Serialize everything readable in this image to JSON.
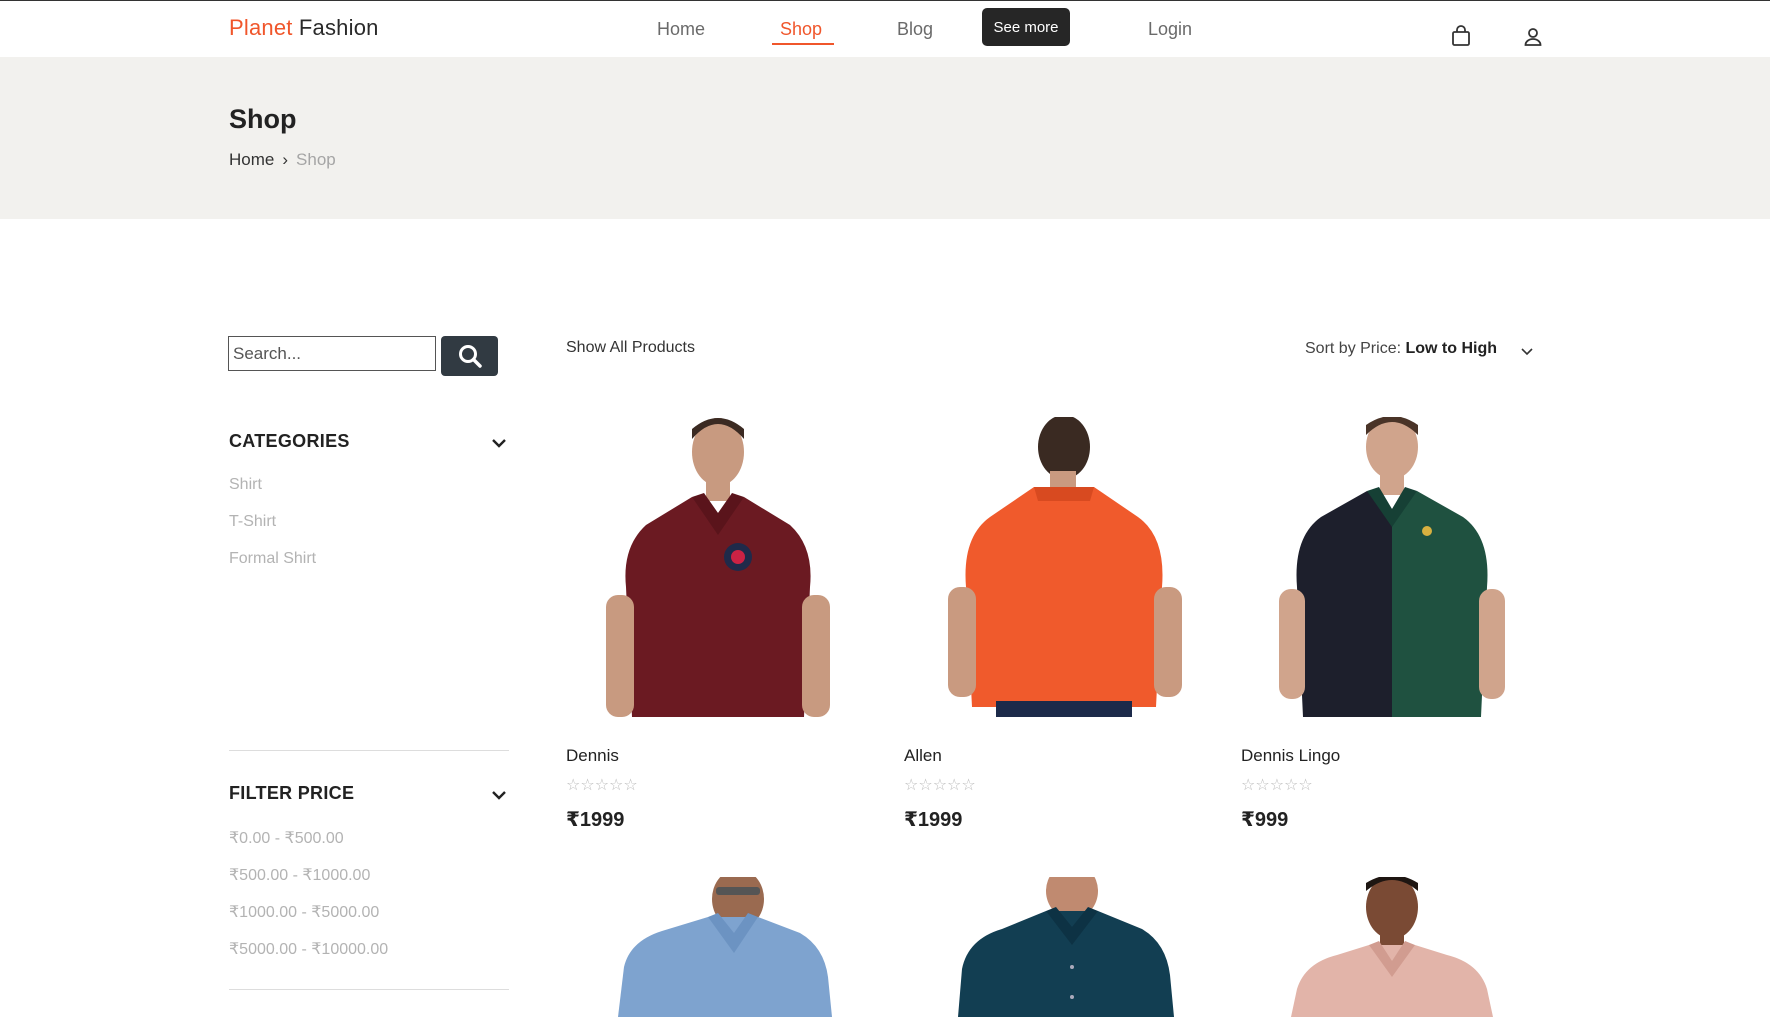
{
  "brand": {
    "part1": "Planet",
    "part2": "Fashion",
    "accent_color": "#f0562b"
  },
  "nav": {
    "home": "Home",
    "shop": "Shop",
    "blog": "Blog",
    "login": "Login",
    "tooltip": "See more"
  },
  "header_icons": [
    "shopping-bag-icon",
    "user-icon"
  ],
  "banner": {
    "title": "Shop",
    "breadcrumb": {
      "home": "Home",
      "separator": "›",
      "current": "Shop"
    }
  },
  "sidebar": {
    "search_placeholder": "Search...",
    "categories": {
      "title": "CATEGORIES",
      "items": [
        "Shirt",
        "T-Shirt",
        "Formal Shirt"
      ]
    },
    "filter_price": {
      "title": "FILTER PRICE",
      "items": [
        "₹0.00 - ₹500.00",
        "₹500.00 - ₹1000.00",
        "₹1000.00 - ₹5000.00",
        "₹5000.00 - ₹10000.00"
      ]
    }
  },
  "toolbar": {
    "show_all": "Show All Products",
    "sort_label": "Sort by Price:",
    "sort_value": "Low to High"
  },
  "products": [
    {
      "name": "Dennis",
      "rating": "☆☆☆☆☆",
      "price": "₹1999",
      "shirt_color": "#6b1a22"
    },
    {
      "name": "Allen",
      "rating": "☆☆☆☆☆",
      "price": "₹1999",
      "shirt_color": "#f05a2c"
    },
    {
      "name": "Dennis Lingo",
      "rating": "☆☆☆☆☆",
      "price": "₹999",
      "shirt_color": "#1f5140"
    },
    {
      "shirt_color": "#7ea3cf"
    },
    {
      "shirt_color": "#123e52"
    },
    {
      "shirt_color": "#e2b4a9"
    }
  ]
}
